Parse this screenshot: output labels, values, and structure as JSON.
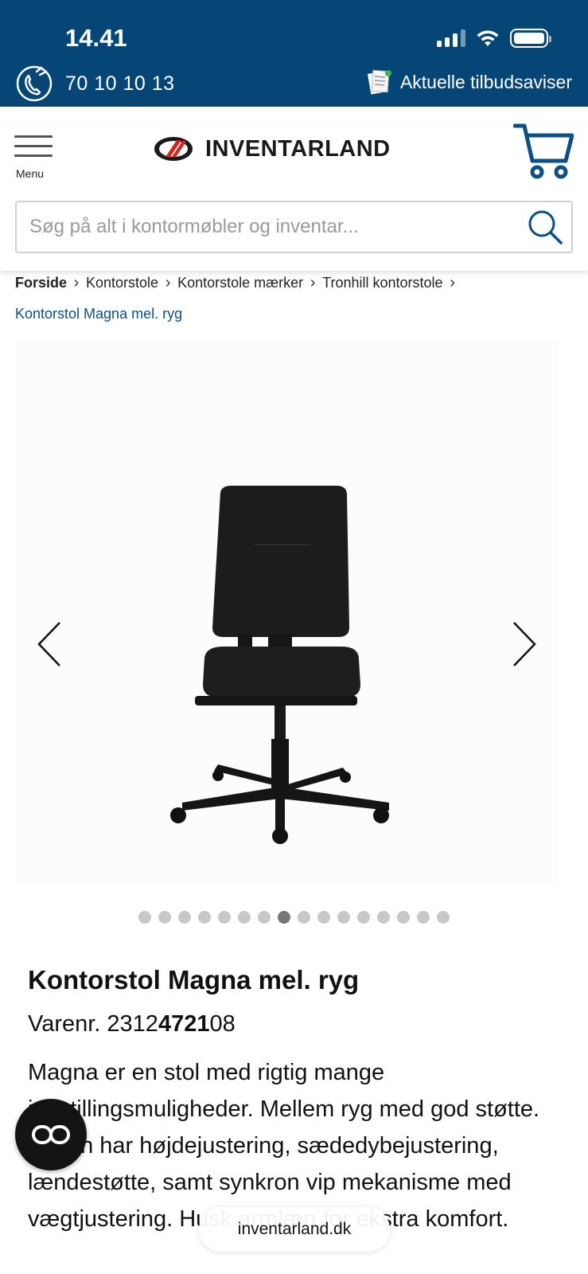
{
  "status_bar": {
    "time": "14.41"
  },
  "topbar": {
    "phone_number": "70 10 10 13",
    "offers_label": "Aktuelle tilbudsaviser"
  },
  "header": {
    "menu_label": "Menu",
    "logo_text": "INVENTARLAND",
    "search_placeholder": "Søg på alt i kontormøbler og inventar...",
    "search_value": ""
  },
  "breadcrumb": {
    "items": [
      "Forside",
      "Kontorstole",
      "Kontorstole mærker",
      "Tronhill kontorstole"
    ],
    "current": "Kontorstol Magna mel. ryg"
  },
  "gallery": {
    "dot_count": 16,
    "active_index": 7
  },
  "product": {
    "title": "Kontorstol Magna mel. ryg",
    "sku_label": "Varenr.",
    "sku_prefix": "2312",
    "sku_highlight": "4721",
    "sku_suffix": "08",
    "description": "Magna er en stol med rigtig mange indstillingsmuligheder. Mellem ryg med god støtte. Stolen har højdejustering, sædedybejustering, lændestøtte, samt synkron vip mekanisme med vægtjustering. Husk armlæn for ekstra komfort."
  },
  "browser": {
    "url": "inventarland.dk"
  },
  "colors": {
    "topbar": "#064676",
    "accent": "#0b4f86",
    "logo_red": "#d8231c",
    "chat_button": "#141414"
  },
  "icons": {
    "phone": "phone-icon",
    "offers": "newspaper-icon",
    "menu": "hamburger-icon",
    "cart": "cart-icon",
    "search": "search-icon",
    "chat": "chat-icon"
  }
}
